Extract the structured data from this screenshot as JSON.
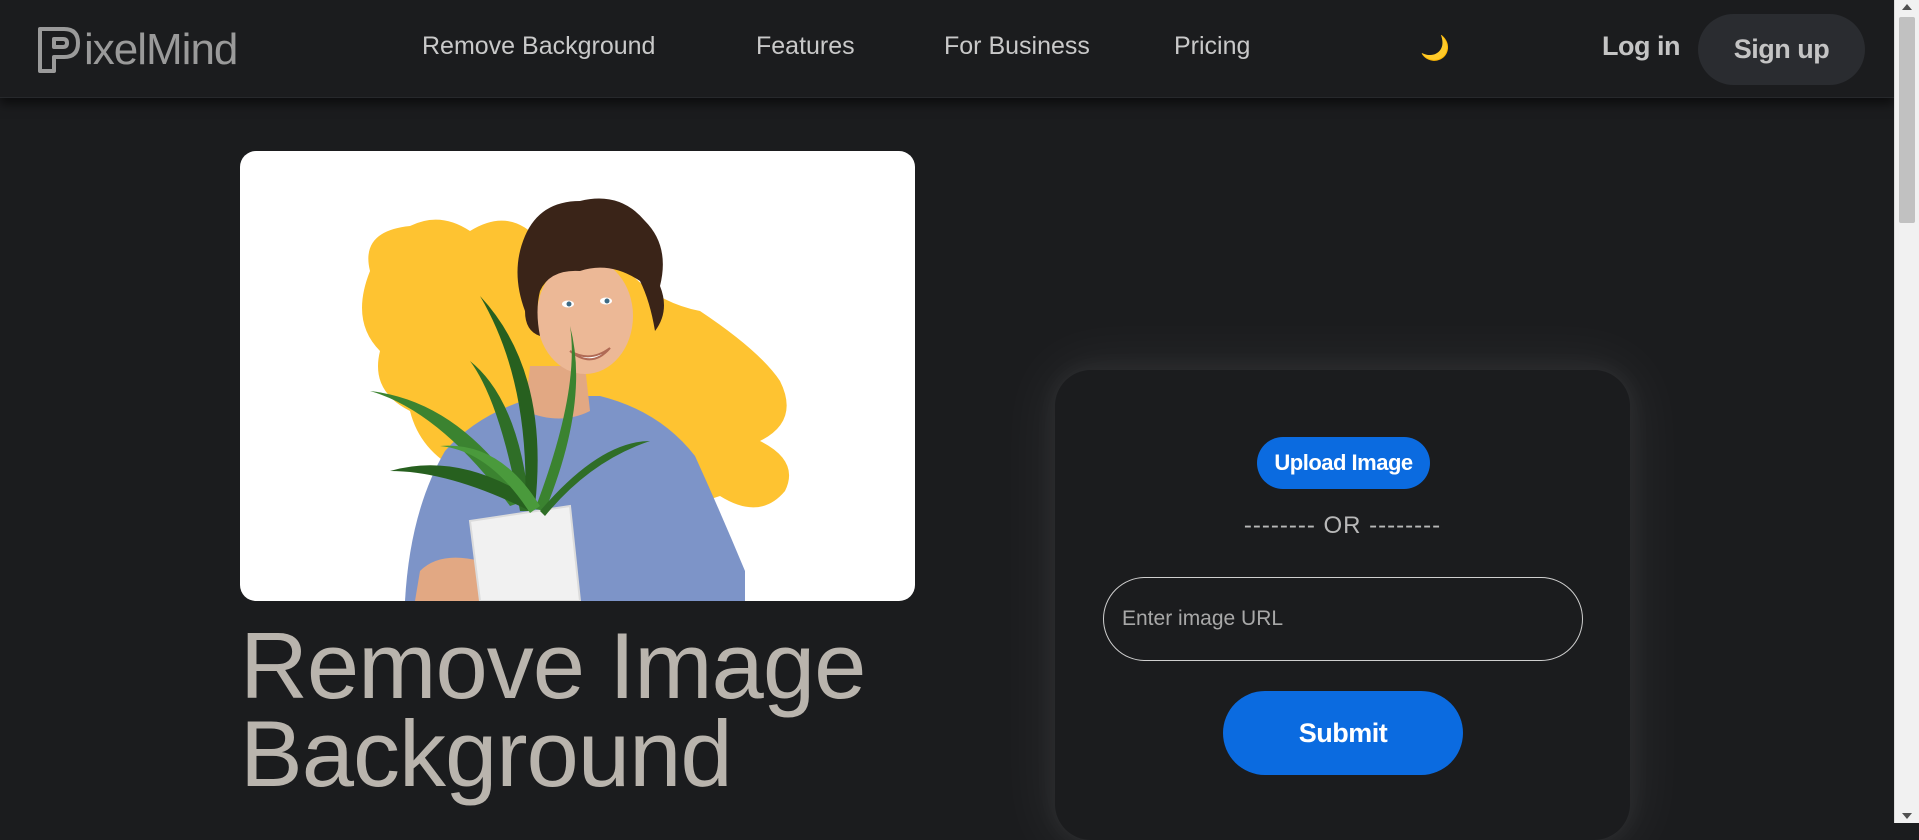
{
  "brand": {
    "logo_text": "ixelMind"
  },
  "nav": {
    "links": [
      "Remove Background",
      "Features",
      "For Business",
      "Pricing"
    ],
    "theme_toggle_glyph": "🌙",
    "login_label": "Log in",
    "signup_label": "Sign up"
  },
  "hero": {
    "image_alt": "Man with curly hair holding a potted plant against a yellow blob",
    "title_line1": "Remove Image",
    "title_line2": "Background"
  },
  "upload": {
    "upload_button_label": "Upload Image",
    "divider_text": "-------- OR --------",
    "url_placeholder": "Enter image URL",
    "submit_label": "Submit"
  },
  "colors": {
    "background": "#1b1c1e",
    "accent": "#0b6be0",
    "blob": "#fec331",
    "shirt": "#7d94c8"
  },
  "icons": {
    "brand": "pixelmind-logo-icon",
    "theme": "moon-icon"
  }
}
